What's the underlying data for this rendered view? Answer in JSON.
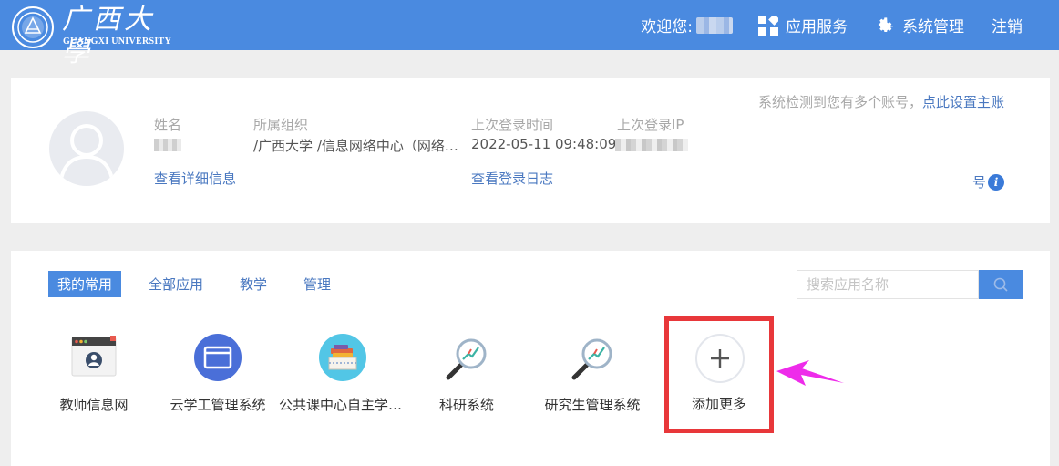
{
  "header": {
    "logo_cn": "广西大學",
    "logo_en": "GUANGXI UNIVERSITY",
    "welcome": "欢迎您:",
    "nav": [
      {
        "label": "应用服务",
        "icon": "apps-grid-icon"
      },
      {
        "label": "系统管理",
        "icon": "gear-icon"
      }
    ],
    "logout": "注销"
  },
  "profile": {
    "name_label": "姓名",
    "org_label": "所属组织",
    "org_value": "/广西大学 /信息网络中心（网络与信息化办公室）",
    "last_login_label": "上次登录时间",
    "last_login_value": "2022-05-11 09:48:09",
    "last_ip_label": "上次登录IP",
    "detail_link": "查看详细信息",
    "log_link": "查看登录日志",
    "notice_text": "系统检测到您有多个账号，",
    "notice_link": "点此设置主账",
    "notice_tail": "号"
  },
  "apps": {
    "tabs": [
      {
        "label": "我的常用",
        "active": true
      },
      {
        "label": "全部应用",
        "active": false
      },
      {
        "label": "教学",
        "active": false
      },
      {
        "label": "管理",
        "active": false
      }
    ],
    "search_placeholder": "搜索应用名称",
    "items": [
      {
        "label": "教师信息网",
        "icon": "teacher-info-icon"
      },
      {
        "label": "云学工管理系统",
        "icon": "window-icon"
      },
      {
        "label": "公共课中心自主学习平台",
        "icon": "books-icon"
      },
      {
        "label": "科研系统",
        "icon": "magnifier-chart-icon"
      },
      {
        "label": "研究生管理系统",
        "icon": "magnifier-chart-icon"
      }
    ],
    "add_more": "添加更多"
  },
  "colors": {
    "primary": "#4a8ae0",
    "link": "#4a78c0",
    "highlight": "#e8373a",
    "arrow": "#ee2bea"
  }
}
